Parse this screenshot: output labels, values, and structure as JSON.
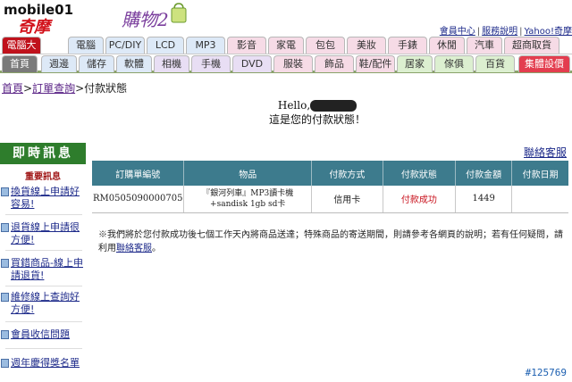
{
  "header": {
    "logo_top": "mobile01",
    "logo_main": "奇摩",
    "shop_label": "購物2",
    "links": [
      "會員中心",
      "服務說明",
      "Yahoo!奇摩"
    ]
  },
  "nav_primary": [
    "電腦大展",
    "電腦",
    "PC/DIY",
    "LCD",
    "MP3",
    "影音",
    "家電",
    "包包",
    "美妝",
    "手錶",
    "休閒",
    "汽車",
    "超商取貨"
  ],
  "nav_secondary": [
    "首頁",
    "週邊",
    "儲存",
    "軟體",
    "相機",
    "手機",
    "DVD",
    "服裝",
    "飾品",
    "鞋/配件",
    "居家",
    "傢俱",
    "百貨",
    "集體設價"
  ],
  "breadcrumb": {
    "home": "首頁",
    "sep1": ">",
    "orders": "訂單查詢",
    "sep2": ">",
    "current": "付款狀態"
  },
  "greeting": {
    "hello": "Hello,",
    "message": "這是您的付款狀態！"
  },
  "sidebar": {
    "title": "即時訊息",
    "subtitle": "重要訊息",
    "items": [
      "換貨線上申請好容易!",
      "退貨線上申請很方便!",
      "買錯商品-線上申請退貨!",
      "維修線上查詢好方便!",
      "會員收信問題",
      "週年慶得獎名單"
    ]
  },
  "main": {
    "contact_link": "聯絡客服",
    "table": {
      "headers": [
        "訂購單編號",
        "物品",
        "付款方式",
        "付款狀態",
        "付款金額",
        "付款日期"
      ],
      "rows": [
        {
          "order_no": "RM0505090000705",
          "item_line1": "『銀河列車』MP3讀卡機",
          "item_line2": "+sandisk 1gb sd卡",
          "method": "信用卡",
          "status": "付款成功",
          "amount": "1449",
          "date": ""
        }
      ]
    },
    "note_text": "※我們將於您付款成功後七個工作天內將商品送達；特殊商品的寄送期間，則請參考各網頁的說明；若有任何疑問，請利用",
    "note_link": "聯絡客服",
    "note_end": "。"
  },
  "watermark": "#125769",
  "colors": {
    "sidebar_header": "#2e7d2c",
    "table_header": "#3d7b8d",
    "status_success": "#c8101b",
    "link": "#1d2a8a"
  }
}
